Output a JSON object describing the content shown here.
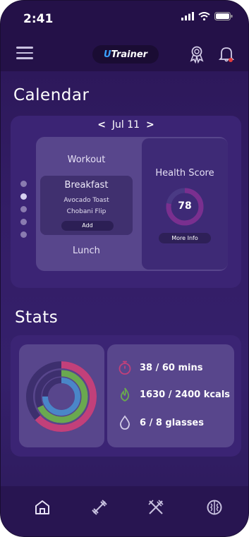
{
  "status_bar": {
    "time": "2:41"
  },
  "app_bar": {
    "logo_prefix": "U",
    "logo_rest": "Trainer"
  },
  "calendar": {
    "title": "Calendar",
    "date": "Jul 11",
    "prev": "<",
    "next": ">",
    "pager_active_index": 1,
    "workout_label": "Workout",
    "breakfast": {
      "title": "Breakfast",
      "items": [
        "Avocado Toast",
        "Chobani Flip"
      ],
      "add_label": "Add"
    },
    "lunch_label": "Lunch",
    "health": {
      "title": "Health Score",
      "score": "78",
      "score_fraction": 0.78,
      "more_label": "More Info"
    }
  },
  "stats": {
    "title": "Stats",
    "exercise": {
      "text": "38 / 60 mins",
      "current": 38,
      "goal": 60,
      "color": "#c2407a"
    },
    "calories": {
      "text": "1630 / 2400 kcals",
      "current": 1630,
      "goal": 2400,
      "color": "#6aa84f"
    },
    "water": {
      "text": "6 / 8 glasses",
      "current": 6,
      "goal": 8,
      "color": "#4a86c8"
    }
  },
  "bottom_nav": [
    "home-icon",
    "dumbbell-icon",
    "utensils-icon",
    "brain-icon"
  ]
}
